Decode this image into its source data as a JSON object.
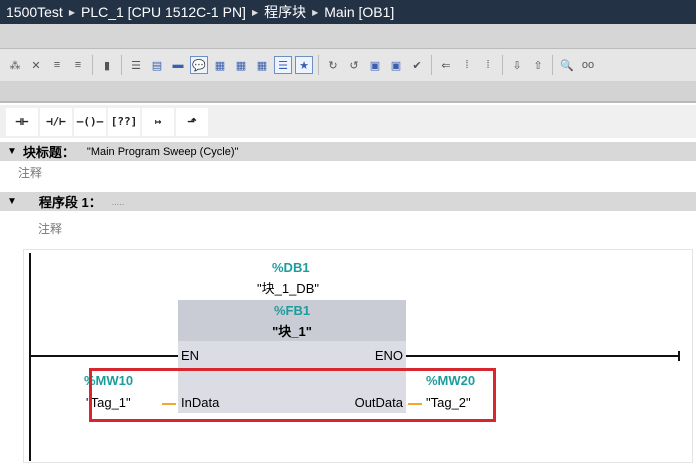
{
  "breadcrumb": [
    "1500Test",
    "PLC_1 [CPU 1512C-1 PN]",
    "程序块",
    "Main [OB1]"
  ],
  "toolbar_icons": [
    "insert-network-icon",
    "delete-network-icon",
    "insert-row-icon",
    "add-row-icon",
    "clear-icon",
    "expand-all-icon",
    "collapse-icon",
    "network-view-icon",
    "comment-icon",
    "absolute-address-icon",
    "symbolic-address-icon",
    "address-toggle-icon",
    "favorites-list-icon",
    "favorites-icon",
    "goto-error-icon",
    "next-error-icon",
    "prev-tag-icon",
    "next-tag-icon",
    "compile-check-icon",
    "monitor-icon",
    "watch-icon",
    "force-icon",
    "download-icon",
    "upload-icon",
    "search-icon",
    "glasses-monitor-icon"
  ],
  "instructions": [
    {
      "name": "no-contact-icon",
      "glyph": "⊣⊢"
    },
    {
      "name": "nc-contact-icon",
      "glyph": "⊣/⊢"
    },
    {
      "name": "coil-icon",
      "glyph": "–()–"
    },
    {
      "name": "empty-box-icon",
      "glyph": "[??]"
    },
    {
      "name": "open-branch-icon",
      "glyph": "↦"
    },
    {
      "name": "close-branch-icon",
      "glyph": "⬏"
    }
  ],
  "block_title": {
    "label": "块标题：",
    "value": "\"Main Program Sweep (Cycle)\"",
    "comment": "注释"
  },
  "network": {
    "label": "程序段 1：",
    "title": ".....",
    "comment": "注释"
  },
  "ladder": {
    "instance_db": "%DB1",
    "instance_db_name": "\"块_1_DB\"",
    "fb": "%FB1",
    "fb_name": "\"块_1\"",
    "en": "EN",
    "eno": "ENO",
    "in_pin": "InData",
    "out_pin": "OutData",
    "in_addr": "%MW10",
    "in_tag": "\"Tag_1\"",
    "out_addr": "%MW20",
    "out_tag": "\"Tag_2\""
  },
  "colors": {
    "highlight": "#d8262f",
    "address": "#1e9c9c",
    "wire_param": "#f0a830"
  }
}
